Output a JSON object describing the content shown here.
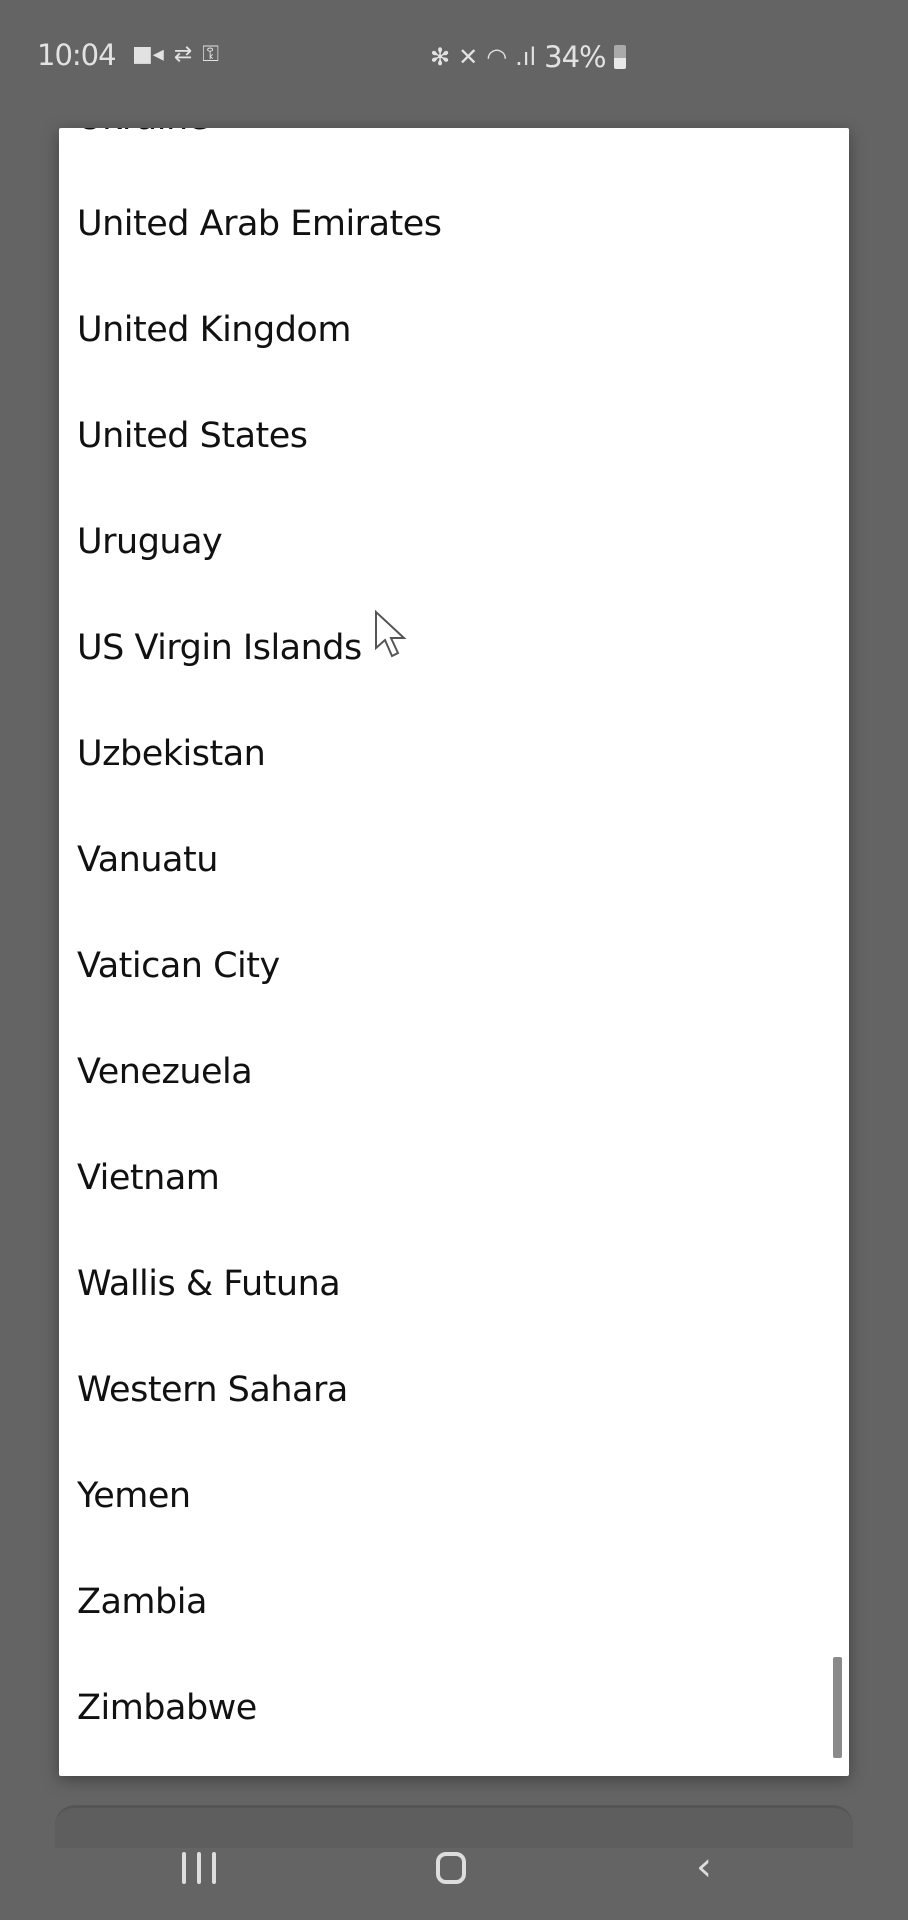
{
  "status_bar": {
    "time": "10:04",
    "left_icons": [
      "video-record-icon",
      "sync-icon",
      "vpn-key-icon"
    ],
    "right_icons": [
      "bluetooth-icon",
      "mute-icon",
      "wifi-icon",
      "signal-icon"
    ],
    "battery_percent": "34%",
    "battery_level": 34
  },
  "country_list": {
    "items": [
      "Ukraine",
      "United Arab Emirates",
      "United Kingdom",
      "United States",
      "Uruguay",
      "US Virgin Islands",
      "Uzbekistan",
      "Vanuatu",
      "Vatican City",
      "Venezuela",
      "Vietnam",
      "Wallis & Futuna",
      "Western Sahara",
      "Yemen",
      "Zambia",
      "Zimbabwe"
    ]
  },
  "nav_bar": {
    "buttons": [
      "recents-icon",
      "home-icon",
      "back-icon"
    ]
  }
}
